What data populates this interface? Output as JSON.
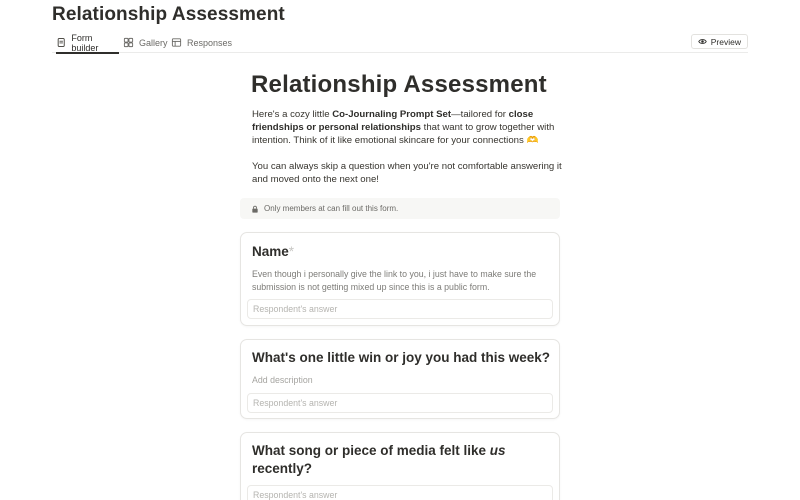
{
  "page": {
    "title": "Relationship Assessment"
  },
  "tabs": [
    {
      "label": "Form builder",
      "icon": "document-icon",
      "active": true
    },
    {
      "label": "Gallery",
      "icon": "grid-icon",
      "active": false
    },
    {
      "label": "Responses",
      "icon": "table-icon",
      "active": false
    }
  ],
  "toolbar": {
    "preview_label": "Preview",
    "preview_icon": "eye-icon"
  },
  "form": {
    "title": "Relationship Assessment",
    "intro": {
      "p1_a": "Here's a cozy little ",
      "p1_b": "Co-Journaling Prompt Set",
      "p1_c": "—tailored for ",
      "p1_d": "close friendships or personal relationships",
      "p1_e": " that want to grow together with intention. Think of it like emotional skincare for your connections 🫶",
      "p2": "You can always skip a question when you're not comfortable answering it and moved onto the next one!"
    },
    "notice": {
      "text": "Only members at can fill out this form.",
      "icon": "lock-icon"
    },
    "questions": [
      {
        "title": "Name",
        "required_mark": "*",
        "description": "Even though i personally give the link to you, i just have to make sure the submission is not getting mixed up since this is a public form.",
        "answer_placeholder": "Respondent's answer"
      },
      {
        "title": "What's one little win or joy you had this week?",
        "description": "Add description",
        "answer_placeholder": "Respondent's answer"
      },
      {
        "title_a": "What song or piece of media felt like ",
        "title_em": "us",
        "title_b": " recently?",
        "answer_placeholder": "Respondent's answer"
      }
    ]
  },
  "colors": {
    "text": "#37352f",
    "muted": "#7d7c78",
    "border": "#e6e5e2",
    "notice_bg": "#f7f7f5"
  }
}
